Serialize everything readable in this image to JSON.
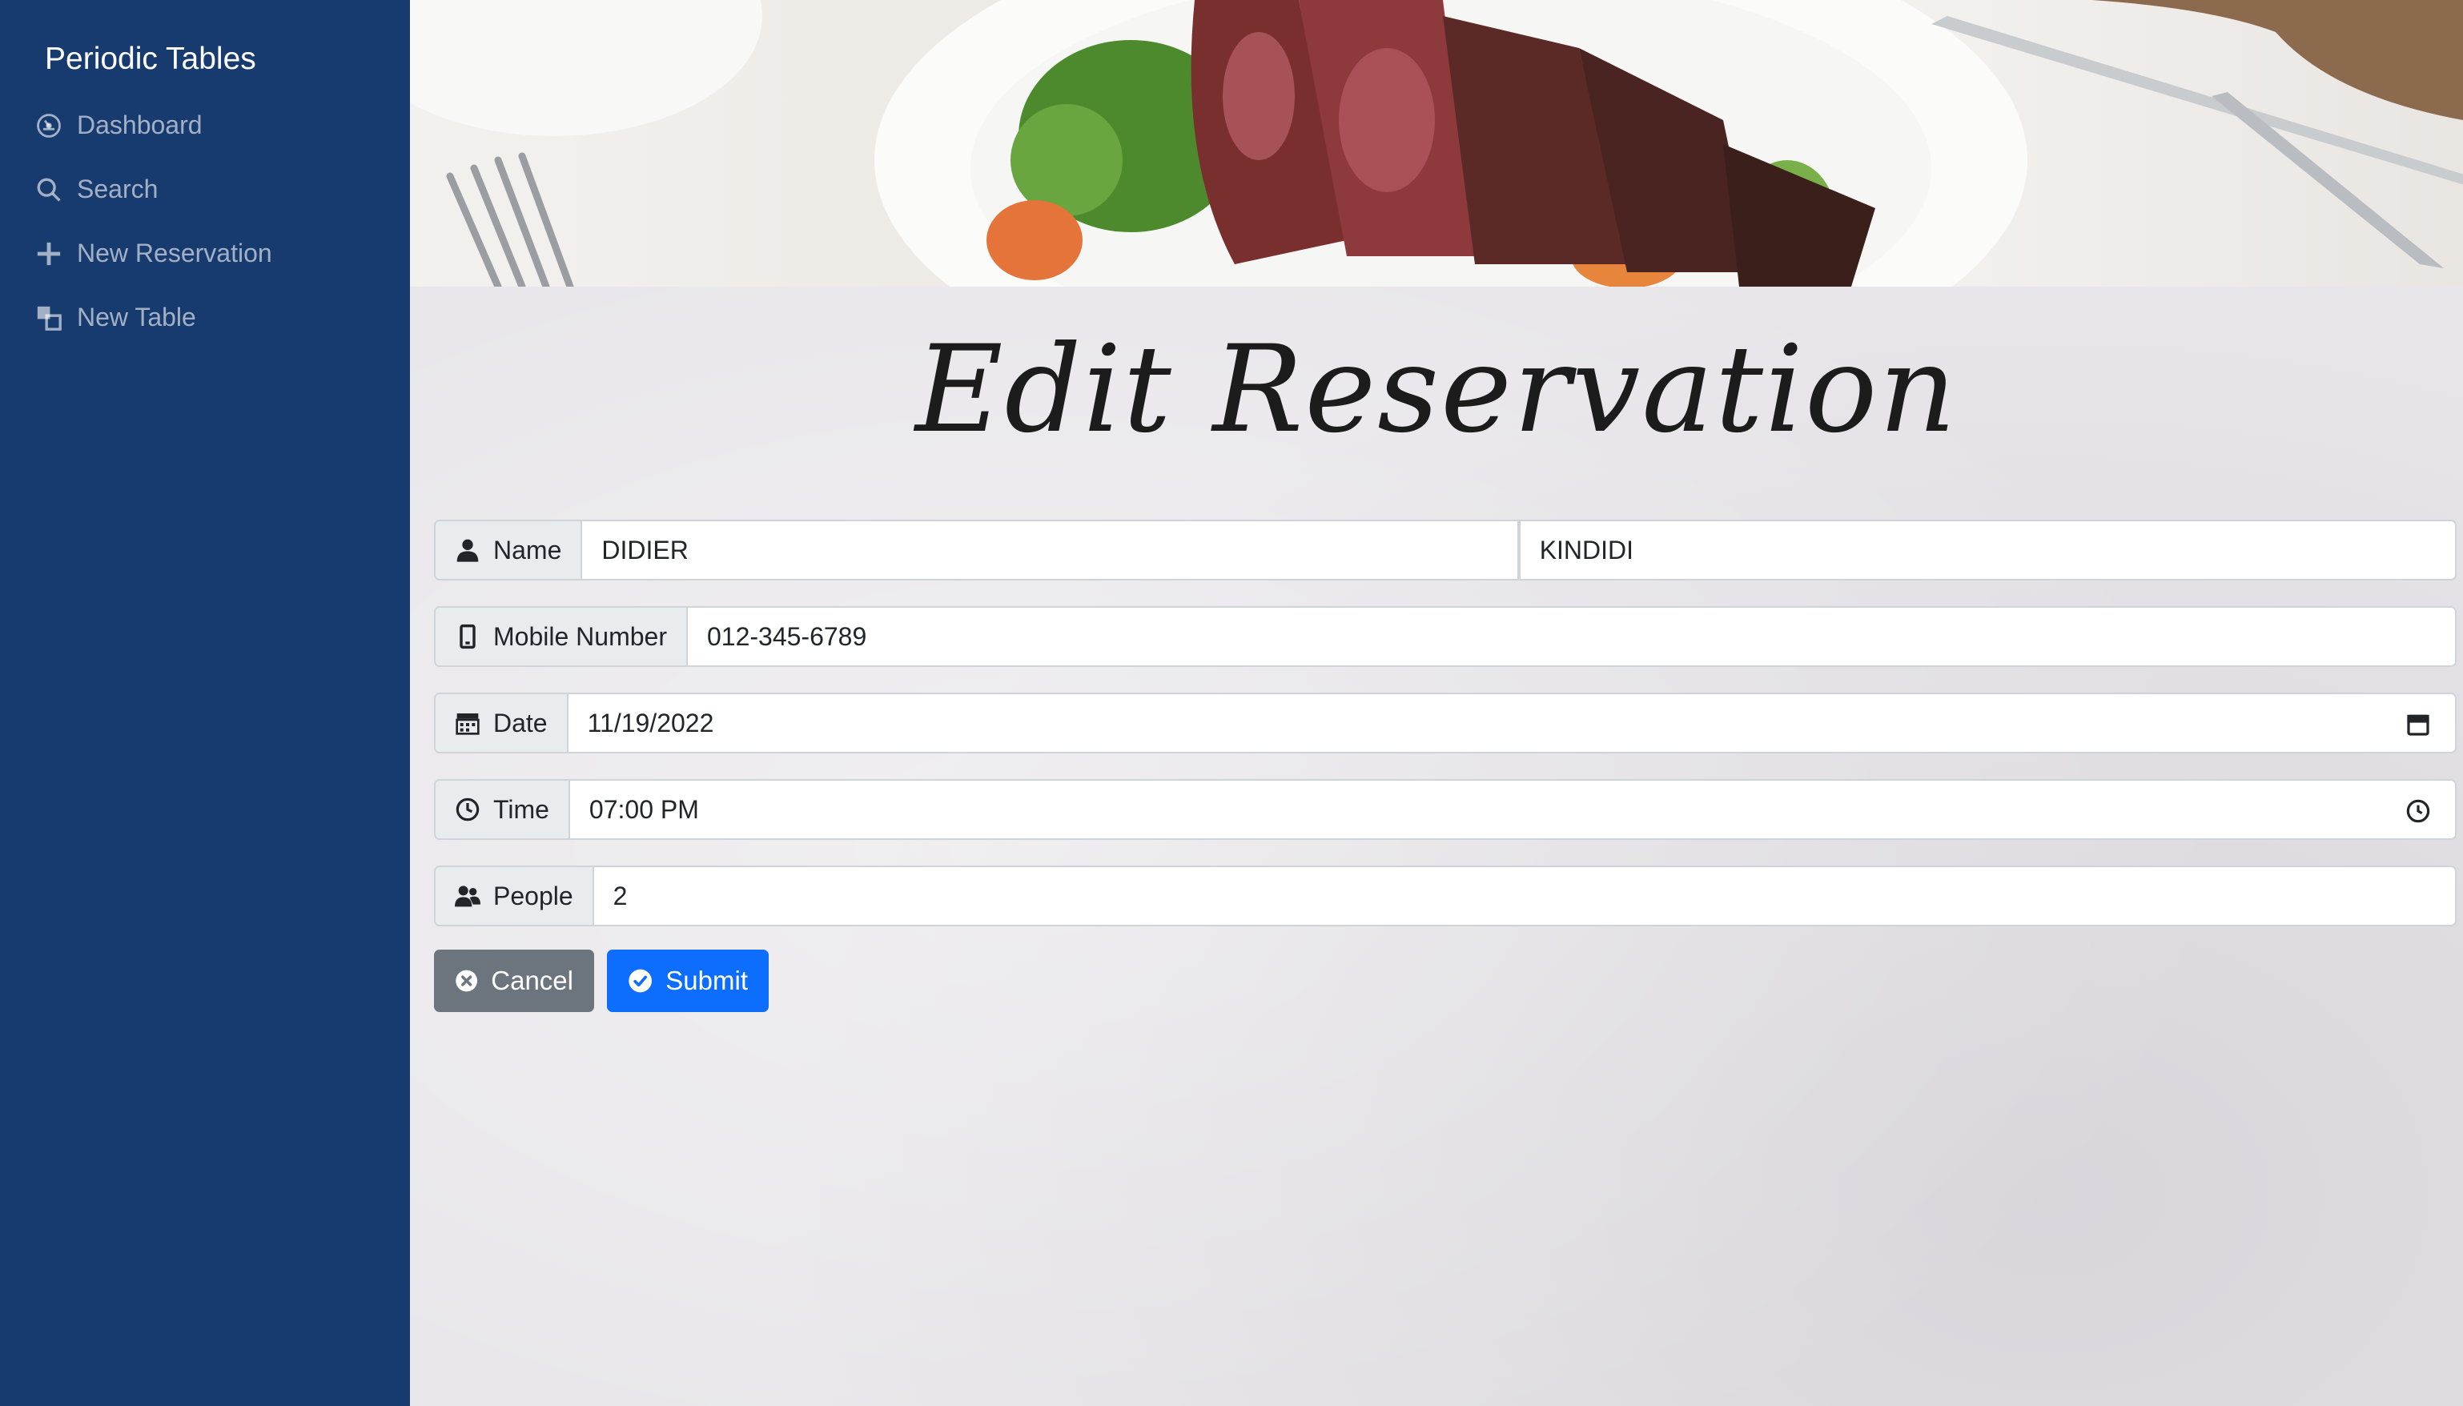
{
  "sidebar": {
    "brand": "Periodic Tables",
    "items": [
      {
        "label": "Dashboard",
        "icon": "dashboard-icon"
      },
      {
        "label": "Search",
        "icon": "search-icon"
      },
      {
        "label": "New Reservation",
        "icon": "plus-icon"
      },
      {
        "label": "New Table",
        "icon": "table-icon"
      }
    ]
  },
  "main": {
    "title": "Edit Reservation",
    "form": {
      "name": {
        "label": "Name",
        "first": "DIDIER",
        "last": "KINDIDI"
      },
      "mobile": {
        "label": "Mobile Number",
        "value": "012-345-6789"
      },
      "date": {
        "label": "Date",
        "value": "11/19/2022"
      },
      "time": {
        "label": "Time",
        "value": "07:00 PM"
      },
      "people": {
        "label": "People",
        "value": "2"
      }
    },
    "buttons": {
      "cancel": "Cancel",
      "submit": "Submit"
    }
  },
  "colors": {
    "sidebar": "#173a6f",
    "submit": "#0d6efd",
    "cancel": "#6c757d"
  }
}
